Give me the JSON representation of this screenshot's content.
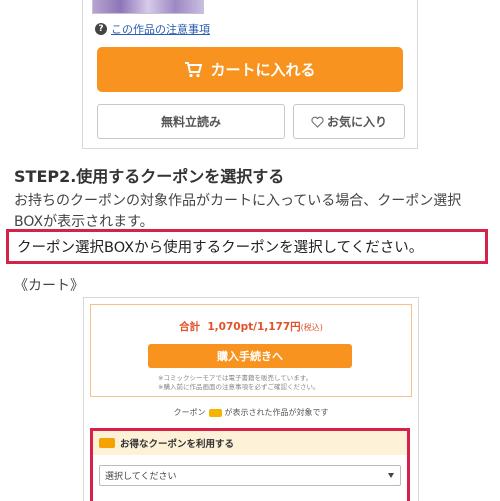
{
  "product": {
    "notice_text": "この作品の注意事項",
    "cart_button_label": "カートに入れる",
    "trial_button_label": "無料立読み",
    "favorite_button_label": "お気に入り"
  },
  "step": {
    "title": "STEP2.使用するクーポンを選択する",
    "description": "お持ちのクーポンの対象作品がカートに入っている場合、クーポン選択BOXが表示されます。",
    "highlight": "クーポン選択BOXから使用するクーポンを選択してください。",
    "cart_label": "《カート》"
  },
  "cart": {
    "total_prefix": "合計",
    "total_value": "1,070pt/1,177円",
    "total_tax": "(税込)",
    "purchase_button_label": "購入手続きへ",
    "note_line1": "※コミックシーモアでは電子書籍を販売しています。",
    "note_line2": "※購入前に作品画面の注意事項を必ずご確認ください。",
    "coupon_target_text_before": "クーポン",
    "coupon_target_text_after": "が表示された作品が対象です",
    "coupon_header": "お得なクーポンを利用する",
    "coupon_select_value": "選択してください"
  },
  "colors": {
    "orange": "#f7931e",
    "highlight_red": "#d5214b",
    "link_blue": "#2a5db0"
  }
}
